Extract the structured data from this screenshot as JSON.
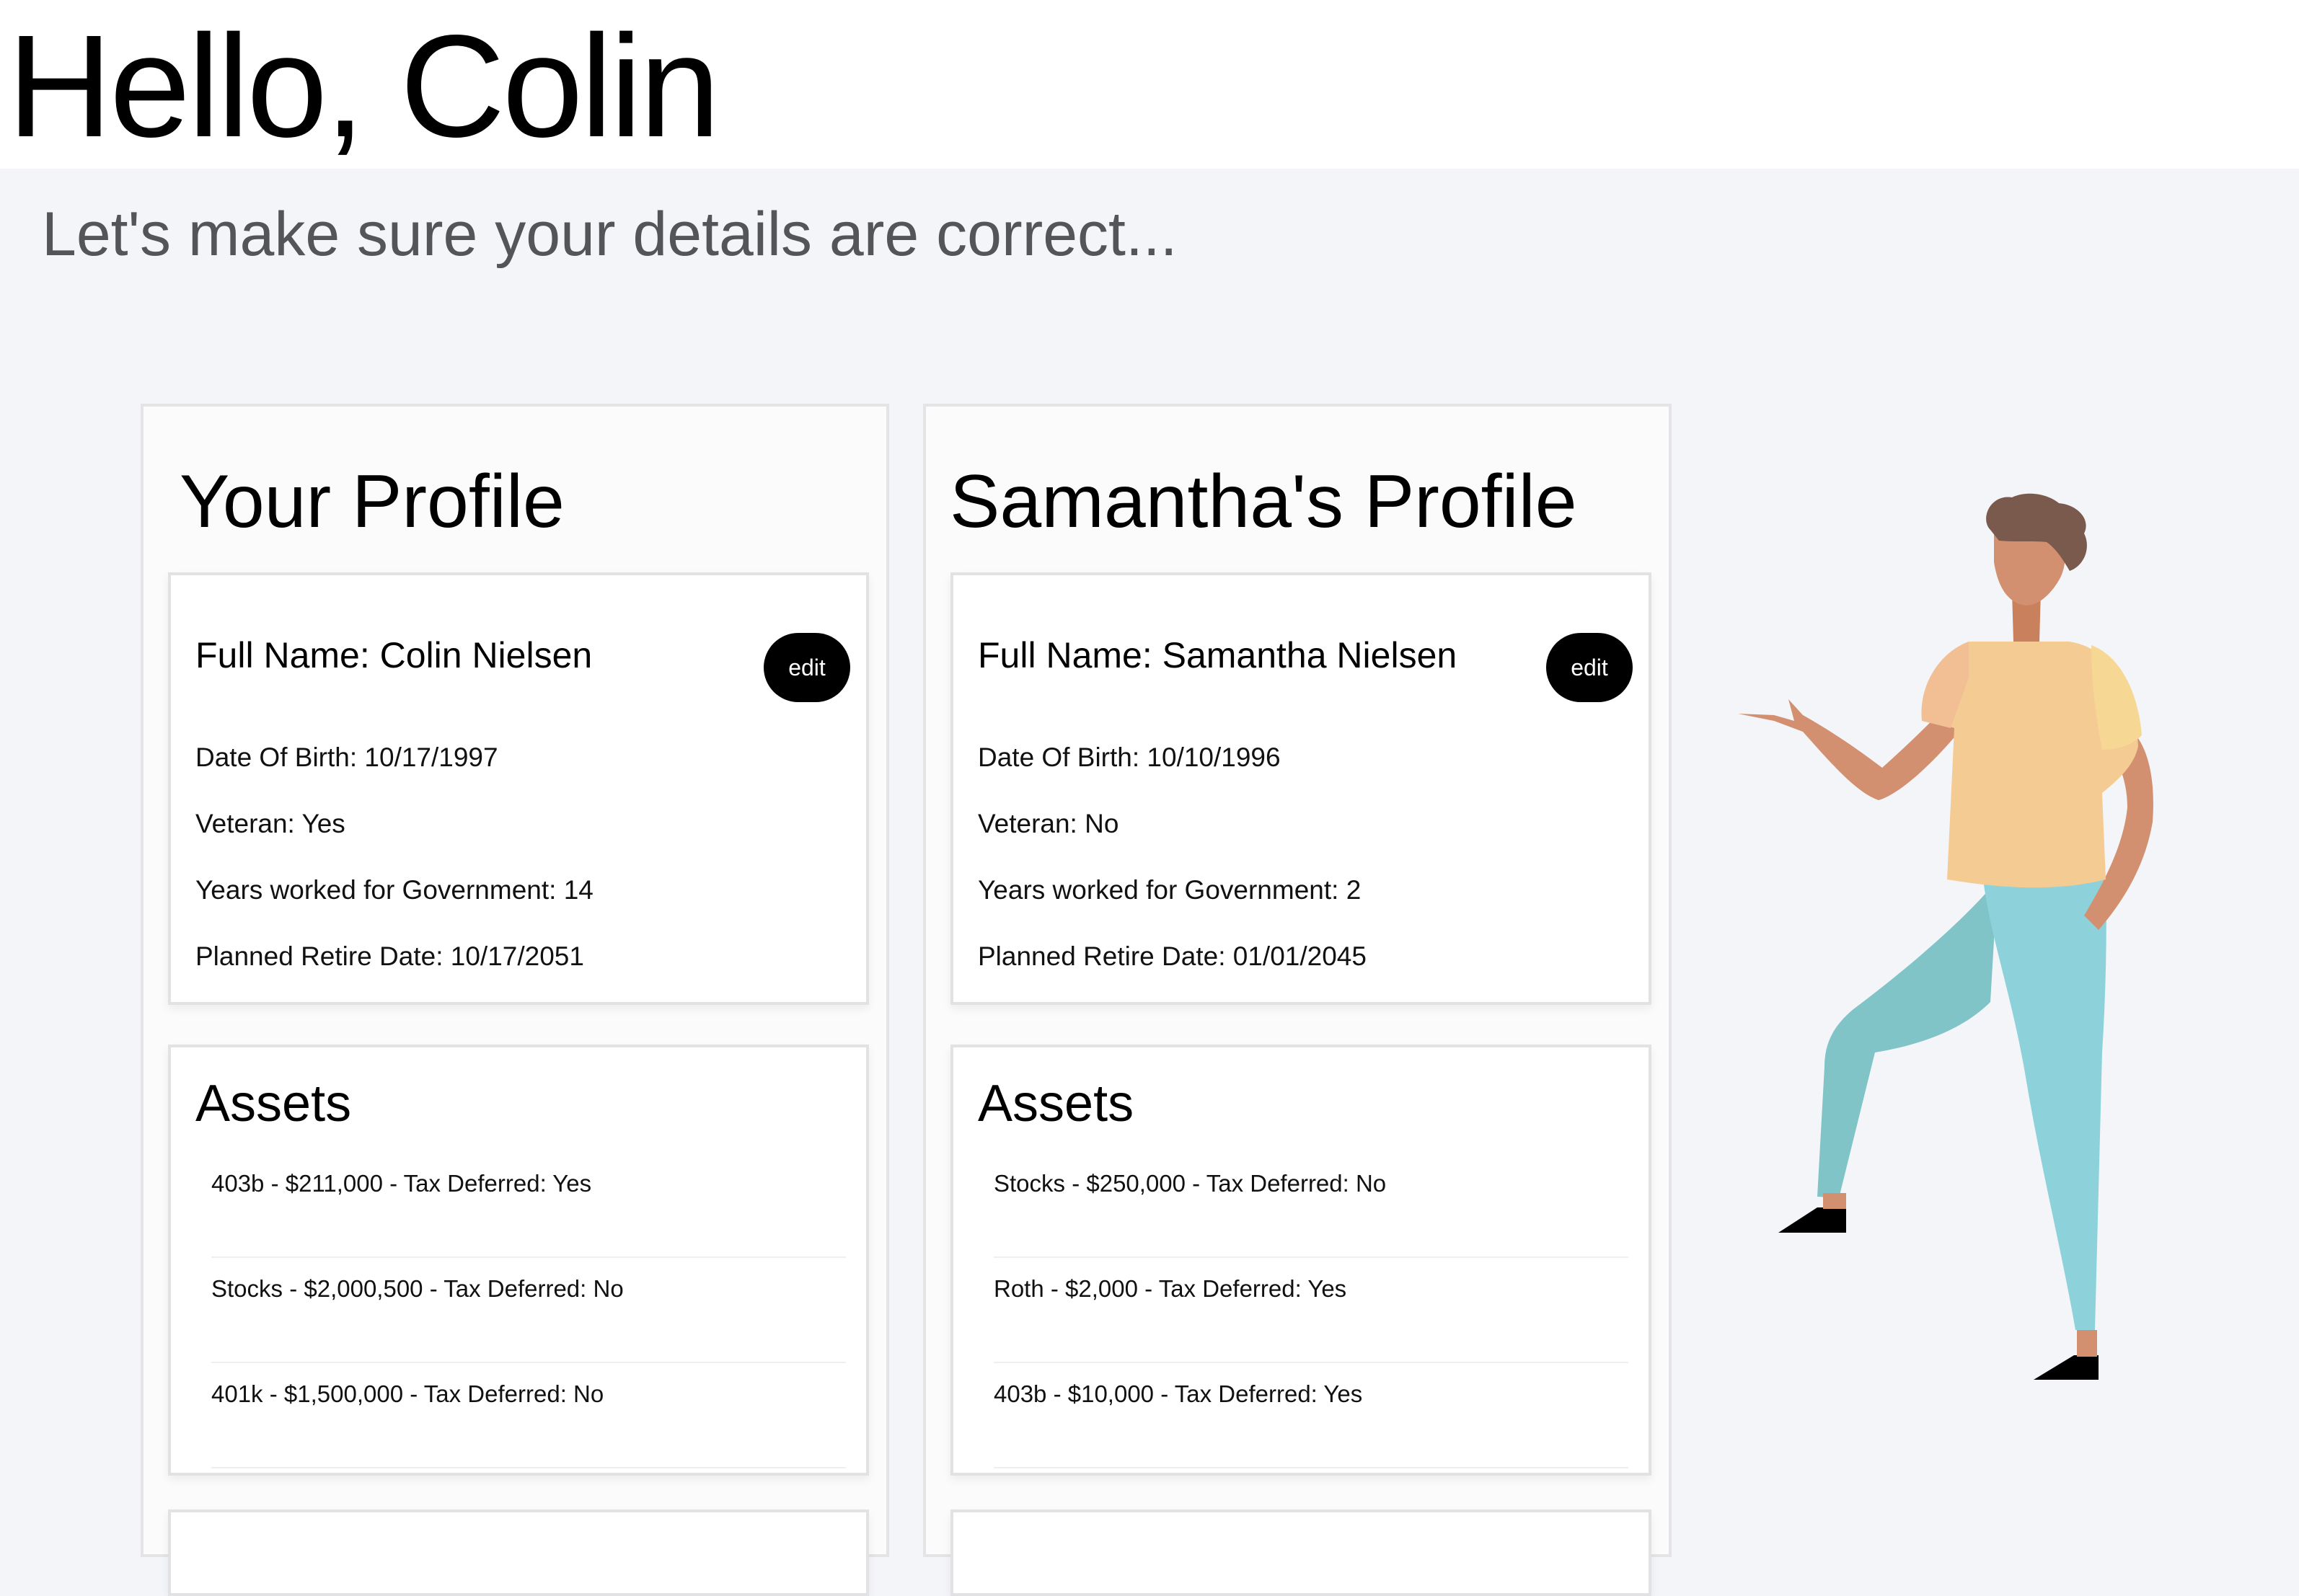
{
  "header": {
    "greeting": "Hello, Colin",
    "subtitle": "Let's make sure your details are correct..."
  },
  "profiles": [
    {
      "heading": "Your Profile",
      "full_name": "Full Name: Colin Nielsen",
      "edit_label": "edit",
      "details": [
        "Date Of Birth: 10/17/1997",
        "Veteran: Yes",
        "Years worked for Government: 14",
        "Planned Retire Date: 10/17/2051"
      ],
      "assets_title": "Assets",
      "assets": [
        "403b - $211,000 - Tax Deferred: Yes",
        "Stocks - $2,000,500 - Tax Deferred: No",
        "401k - $1,500,000 - Tax Deferred: No"
      ]
    },
    {
      "heading": "Samantha's Profile",
      "full_name": "Full Name: Samantha Nielsen",
      "edit_label": "edit",
      "details": [
        "Date Of Birth: 10/10/1996",
        "Veteran: No",
        "Years worked for Government: 2",
        "Planned Retire Date: 01/01/2045"
      ],
      "assets_title": "Assets",
      "assets": [
        "Stocks - $250,000 - Tax Deferred: No",
        "Roth - $2,000 - Tax Deferred: Yes",
        "403b - $10,000 - Tax Deferred: Yes"
      ]
    }
  ],
  "illustration": {
    "icon": "presenting-person-illustration"
  }
}
